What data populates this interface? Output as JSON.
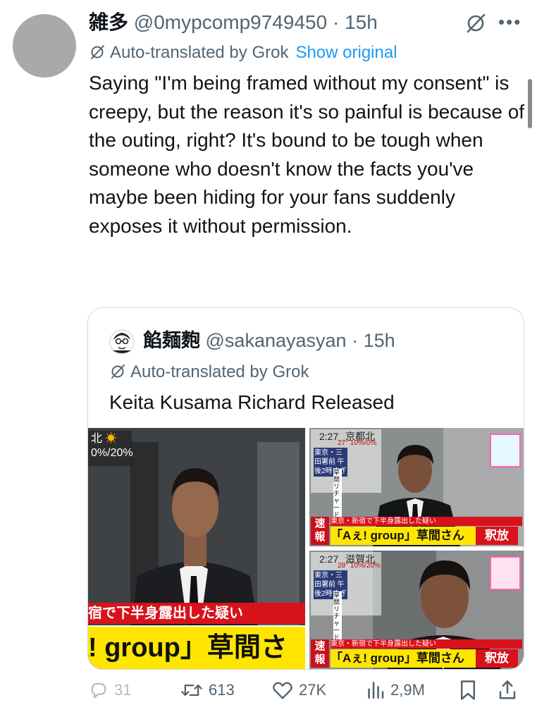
{
  "tweet": {
    "display_name": "雑多",
    "handle": "@0mypcomp9749450",
    "separator": "·",
    "time": "15h",
    "translated_label": "Auto-translated by Grok",
    "show_original": "Show original",
    "text": "Saying \"I'm being framed without my consent\" is creepy, but the reason it's so painful is because of the outing, right? It's bound to be tough when someone who doesn't know the facts you've maybe been hiding for your fans suddenly exposes it without permission.",
    "more_icon": "more-icon",
    "grok_icon": "grok-icon"
  },
  "quote": {
    "display_name": "餡麺麭",
    "handle": "@sakanayasyan",
    "separator": "·",
    "time": "15h",
    "translated_label": "Auto-translated by Grok",
    "text": "Keita Kusama Richard Released",
    "images": {
      "left": {
        "weather_city": "北",
        "weather_pct": "0%/20%",
        "caption_top": "宿で下半身露出した疑い",
        "caption_main": "! group」草間さ"
      },
      "top_right": {
        "time": "2:27",
        "city": "京都北",
        "temp": "27° 10%/0%",
        "side_text": "東京・三田署前 午後2時すぎ",
        "vertical": "草間リチャード敬太さん",
        "flash1": "速",
        "flash2": "報",
        "caption_top": "東京・新宿で下半身露出した疑い",
        "caption_main": "「Aぇ! group」草間さん",
        "release": "釈放"
      },
      "bottom_right": {
        "time": "2:27",
        "city": "滋賀北",
        "temp": "28° 10%/20%",
        "side_text": "東京・三田署前 午後2時すぎ",
        "vertical": "草間リチャード敬太さん",
        "flash1": "速",
        "flash2": "報",
        "caption_top": "東京・新宿で下半身露出した疑い",
        "caption_main": "「Aぇ! group」草間さん",
        "release": "釈放"
      }
    }
  },
  "actions": {
    "reply_count": "31",
    "retweet_count": "613",
    "like_count": "27K",
    "views_count": "2,9M"
  },
  "colors": {
    "text": "#0f1419",
    "muted": "#536471",
    "link": "#1d9bf0",
    "border": "#cfd9de",
    "caption_yellow": "#ffe600",
    "caption_red": "#d8121b"
  }
}
